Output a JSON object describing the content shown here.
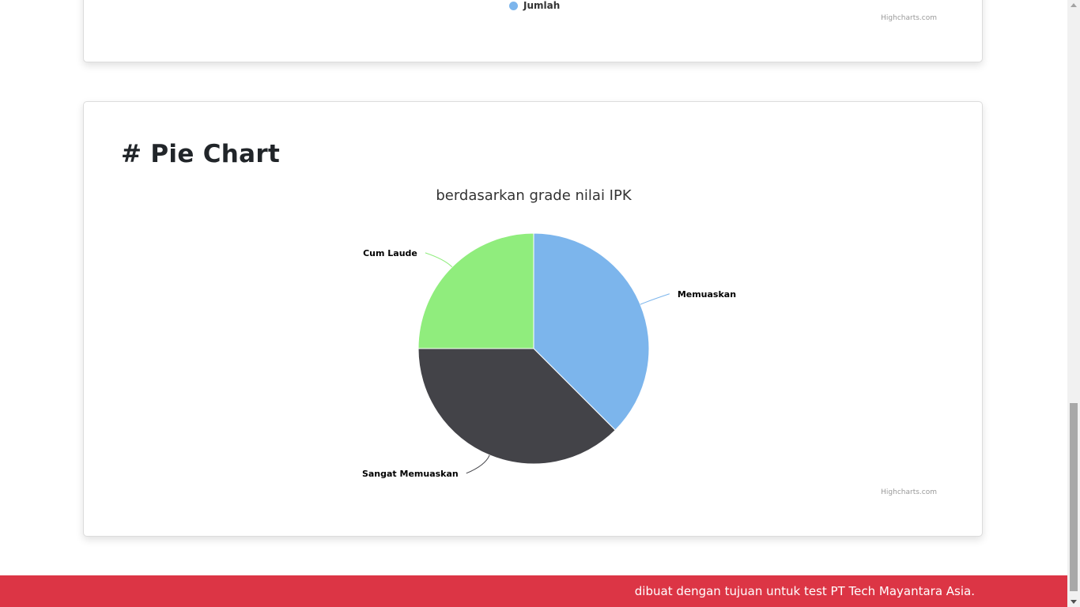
{
  "top_chart": {
    "legend_label": "Jumlah",
    "legend_color": "#7cb5ec",
    "credits": "Highcharts.com"
  },
  "pie_section": {
    "heading": "# Pie Chart",
    "credits": "Highcharts.com"
  },
  "chart_data": {
    "type": "pie",
    "title": "berdasarkan grade nilai IPK",
    "slices": [
      {
        "label": "Memuaskan",
        "value": 37.5,
        "color": "#7cb5ec"
      },
      {
        "label": "Sangat Memuaskan",
        "value": 37.5,
        "color": "#434348"
      },
      {
        "label": "Cum Laude",
        "value": 25,
        "color": "#90ed7d"
      }
    ]
  },
  "footer": {
    "text": "dibuat dengan tujuan untuk test PT Tech Mayantara Asia.",
    "color": "#dc3545"
  }
}
